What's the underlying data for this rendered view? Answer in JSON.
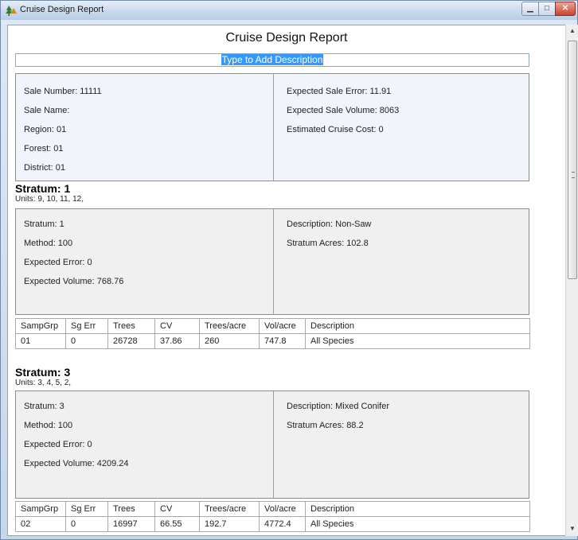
{
  "window": {
    "title": "Cruise Design Report",
    "accent": "#3399ff"
  },
  "report": {
    "title": "Cruise Design Report",
    "description_placeholder": "Type to Add Description"
  },
  "sale": {
    "left": [
      "Sale Number: 11111",
      "Sale Name:",
      "Region: 01",
      "Forest: 01",
      "District: 01"
    ],
    "right": [
      "Expected Sale Error: 11.91",
      "Expected Sale Volume: 8063",
      "Estimated Cruise Cost: 0"
    ]
  },
  "table_headers": [
    "SampGrp",
    "Sg Err",
    "Trees",
    "CV",
    "Trees/acre",
    "Vol/acre",
    "Description"
  ],
  "strata": [
    {
      "heading": "Stratum:  1",
      "units": "Units: 9, 10, 11, 12,",
      "left": [
        "Stratum: 1",
        "Method: 100",
        "Expected Error: 0",
        "Expected Volume: 768.76"
      ],
      "right": [
        "Description: Non-Saw",
        "Stratum Acres: 102.8"
      ],
      "rows": [
        [
          "01",
          "0",
          "26728",
          "37.86",
          "260",
          "747.8",
          "All Species"
        ]
      ]
    },
    {
      "heading": "Stratum:  3",
      "units": "Units: 3, 4, 5, 2,",
      "left": [
        "Stratum: 3",
        "Method: 100",
        "Expected Error: 0",
        "Expected Volume: 4209.24"
      ],
      "right": [
        "Description: Mixed Conifer",
        "Stratum Acres: 88.2"
      ],
      "rows": [
        [
          "02",
          "0",
          "16997",
          "66.55",
          "192.7",
          "4772.4",
          "All Species"
        ]
      ]
    }
  ]
}
